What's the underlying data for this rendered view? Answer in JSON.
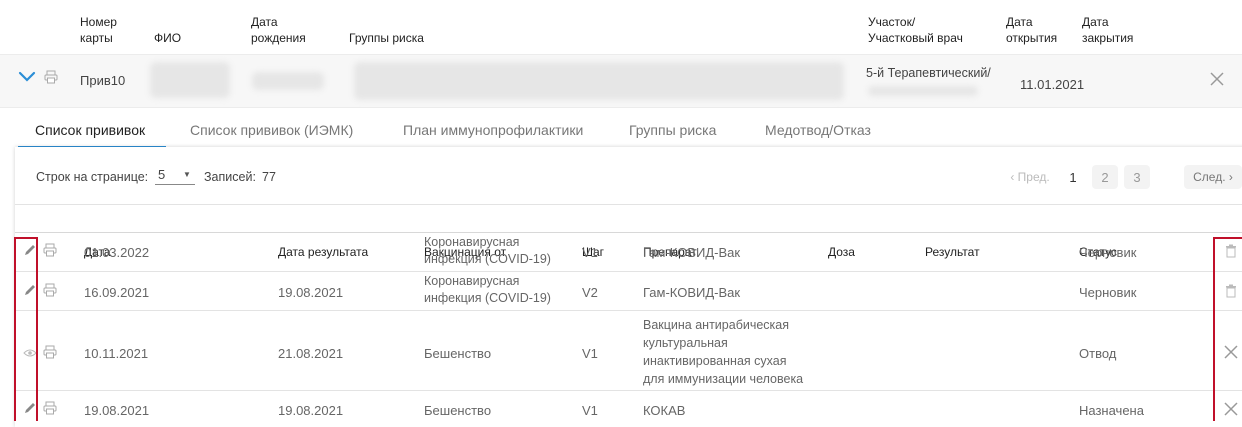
{
  "header": {
    "card_number": "Номер\nкарты",
    "fio": "ФИО",
    "birth_date": "Дата\nрождения",
    "risk_groups": "Группы риска",
    "district": "Участок/\nУчастковый врач",
    "open_date": "Дата\nоткрытия",
    "close_date": "Дата\nзакрытия"
  },
  "record": {
    "card_number": "Прив10",
    "district": "5-й Терапевтический/",
    "open_date": "11.01.2021"
  },
  "tabs": [
    {
      "label": "Список прививок",
      "active": true
    },
    {
      "label": "Список прививок (ИЭМК)",
      "active": false
    },
    {
      "label": "План иммунопрофилактики",
      "active": false
    },
    {
      "label": "Группы риска",
      "active": false
    },
    {
      "label": "Медотвод/Отказ",
      "active": false
    }
  ],
  "toolbar": {
    "rows_per_page_label": "Строк на странице:",
    "rows_per_page_value": "5",
    "records_label": "Записей:",
    "records_count": "77",
    "prev": "‹ Пред.",
    "pages": [
      "1",
      "2",
      "3"
    ],
    "next": "След. ›"
  },
  "table": {
    "columns": [
      "Дата",
      "Дата результата",
      "Вакцинация от",
      "Шаг",
      "Препарат",
      "Доза",
      "Результат",
      "Статус"
    ],
    "rows": [
      {
        "date": "01.03.2022",
        "result_date": "",
        "vaccination": "Коронавирусная\nинфекция (COVID-19)",
        "step": "V1",
        "drug": "Гам-КОВИД-Вак",
        "dose": "",
        "result": "",
        "status": "Черновик"
      },
      {
        "date": "16.09.2021",
        "result_date": "19.08.2021",
        "vaccination": "Коронавирусная\nинфекция (COVID-19)",
        "step": "V2",
        "drug": "Гам-КОВИД-Вак",
        "dose": "",
        "result": "",
        "status": "Черновик"
      },
      {
        "date": "10.11.2021",
        "result_date": "21.08.2021",
        "vaccination": "Бешенство",
        "step": "V1",
        "drug": "Вакцина антирабическая\nкультуральная\nинактивированная сухая\nдля иммунизации человека",
        "dose": "",
        "result": "",
        "status": "Отвод"
      },
      {
        "date": "19.08.2021",
        "result_date": "19.08.2021",
        "vaccination": "Бешенство",
        "step": "V1",
        "drug": "КОКАВ",
        "dose": "",
        "result": "",
        "status": "Назначена"
      }
    ]
  },
  "colors": {
    "accent": "#2b8ed6",
    "highlight": "#c0102a",
    "border": "#e3e3e3"
  }
}
